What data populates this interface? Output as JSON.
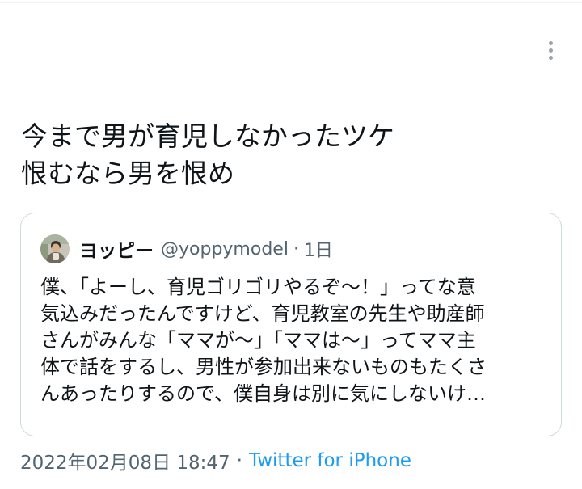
{
  "tweet": {
    "text_lines": [
      "今まで男が育児しなかったツケ",
      "恨むなら男を恨め"
    ],
    "date": "2022年02月08日 18:47",
    "separator": "·",
    "source": "Twitter for iPhone",
    "more_icon": "more-vertical-icon"
  },
  "quote": {
    "display_name": "ヨッピー",
    "handle": "@yoppymodel",
    "separator": "·",
    "time": "1日",
    "body_lines": [
      "僕、「よーし、育児ゴリゴリやるぞ〜！」ってな意",
      "気込みだったんですけど、育児教室の先生や助産師",
      "さんがみんな「ママが〜」「ママは〜」ってママ主",
      "体で話をするし、男性が参加出来ないものもたくさ",
      "んあったりするので、僕自身は別に気にしないけ…"
    ]
  },
  "colors": {
    "text": "#0f1419",
    "secondary": "#536471",
    "link": "#1d9bf0",
    "border": "#cfd9de"
  }
}
